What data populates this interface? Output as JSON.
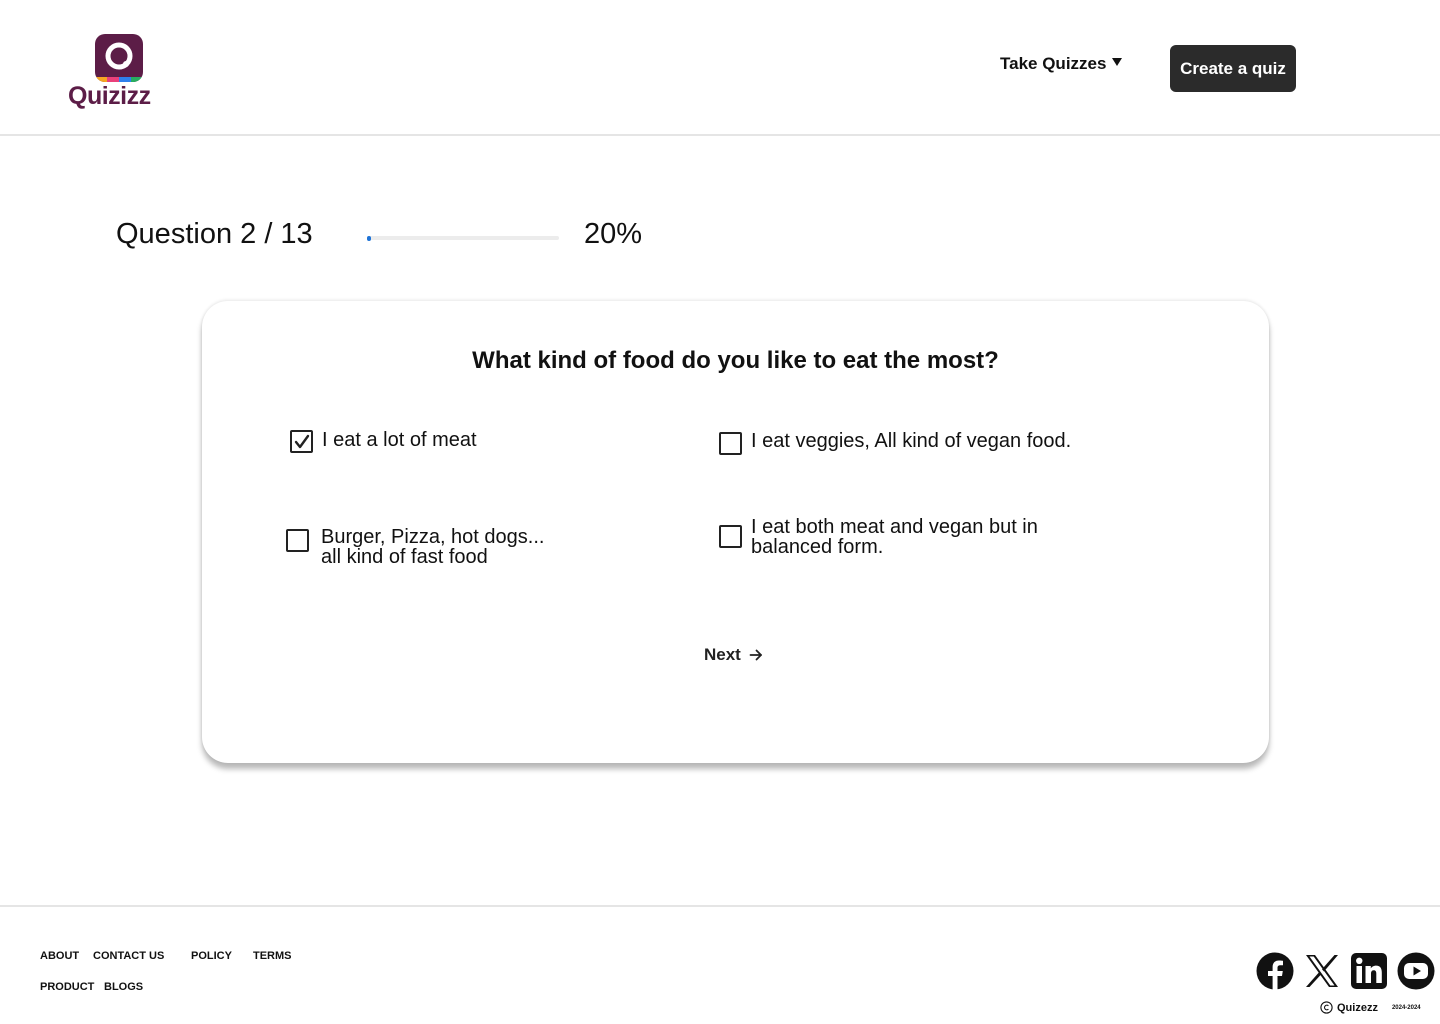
{
  "brand": {
    "name": "Quizizz",
    "colors": {
      "primary": "#5c1d47",
      "stripes": [
        "#f5a623",
        "#e9407a",
        "#2f80ed",
        "#27ae60"
      ]
    }
  },
  "header": {
    "nav_take_label": "Take Quizzes",
    "create_label": "Create a quiz"
  },
  "progress": {
    "counter": "Question 2 / 13",
    "percent_label": "20%",
    "fraction": 0.02,
    "fill_color": "#1e73d6"
  },
  "question": {
    "text": "What kind of food do you like to eat the most?",
    "options": [
      {
        "label": "I eat a lot of meat",
        "checked": true
      },
      {
        "label": "I eat veggies, All kind of vegan food.",
        "checked": false
      },
      {
        "label": "Burger, Pizza, hot dogs...\nall kind of fast food",
        "checked": false
      },
      {
        "label": "I eat both meat and vegan but in\nbalanced form.",
        "checked": false
      }
    ],
    "next_label": "Next"
  },
  "footer": {
    "links": [
      "ABOUT",
      "CONTACT US",
      "POLICY",
      "TERMS",
      "PRODUCT",
      "BLOGS"
    ],
    "social_icons": [
      "facebook-icon",
      "x-icon",
      "linkedin-icon",
      "youtube-icon"
    ],
    "copyright_name": "Quizezz",
    "copyright_years": "2024-2024"
  }
}
